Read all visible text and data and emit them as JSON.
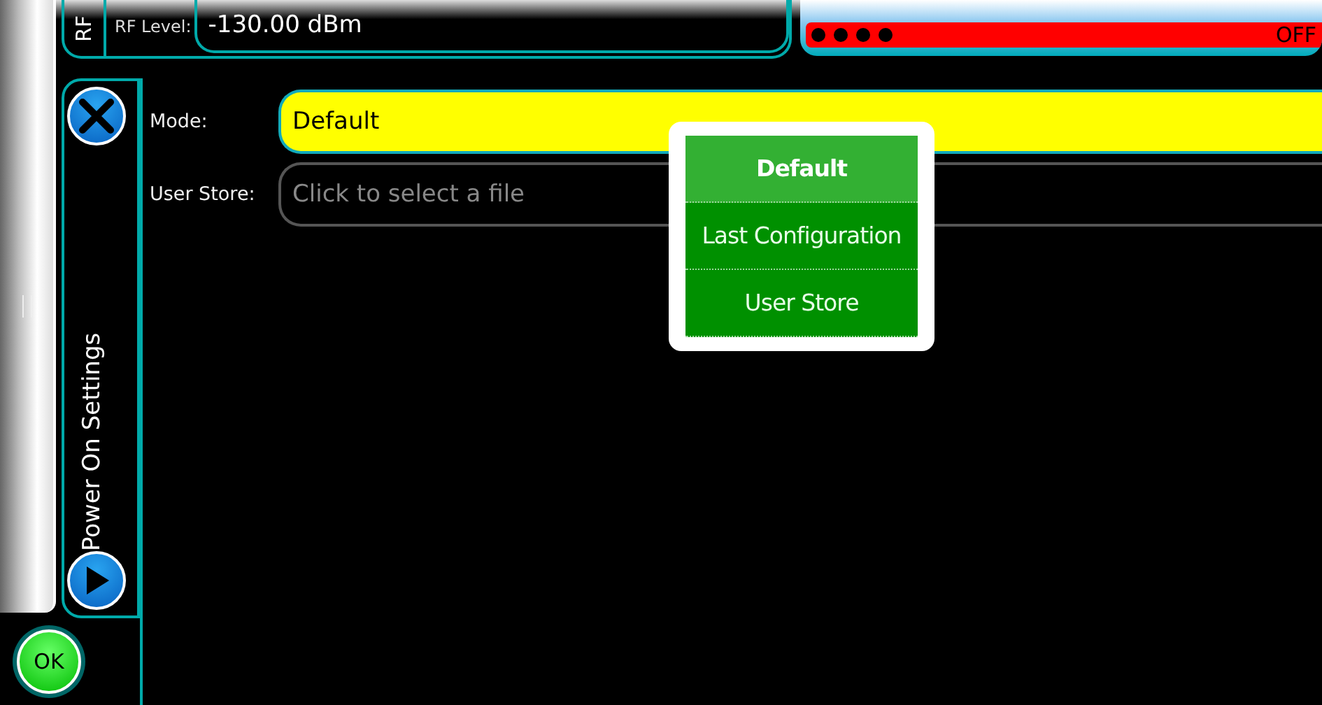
{
  "rf": {
    "tab_label": "RF",
    "level_label": "RF Level:",
    "level_value": "-130.00 dBm",
    "output": {
      "on": false,
      "state_text": "OFF"
    }
  },
  "panel": {
    "title": "Power On Settings",
    "fields": [
      {
        "kind": "select",
        "label": "Mode:",
        "value": "Default",
        "active": true
      },
      {
        "kind": "file",
        "label": "User Store:",
        "placeholder": "Click to select a file",
        "active": false
      }
    ]
  },
  "dropdown": {
    "options": [
      {
        "label": "Default",
        "selected": true
      },
      {
        "label": "Last Configuration",
        "selected": false
      },
      {
        "label": "User Store",
        "selected": false
      }
    ]
  },
  "ok_button": "OK"
}
